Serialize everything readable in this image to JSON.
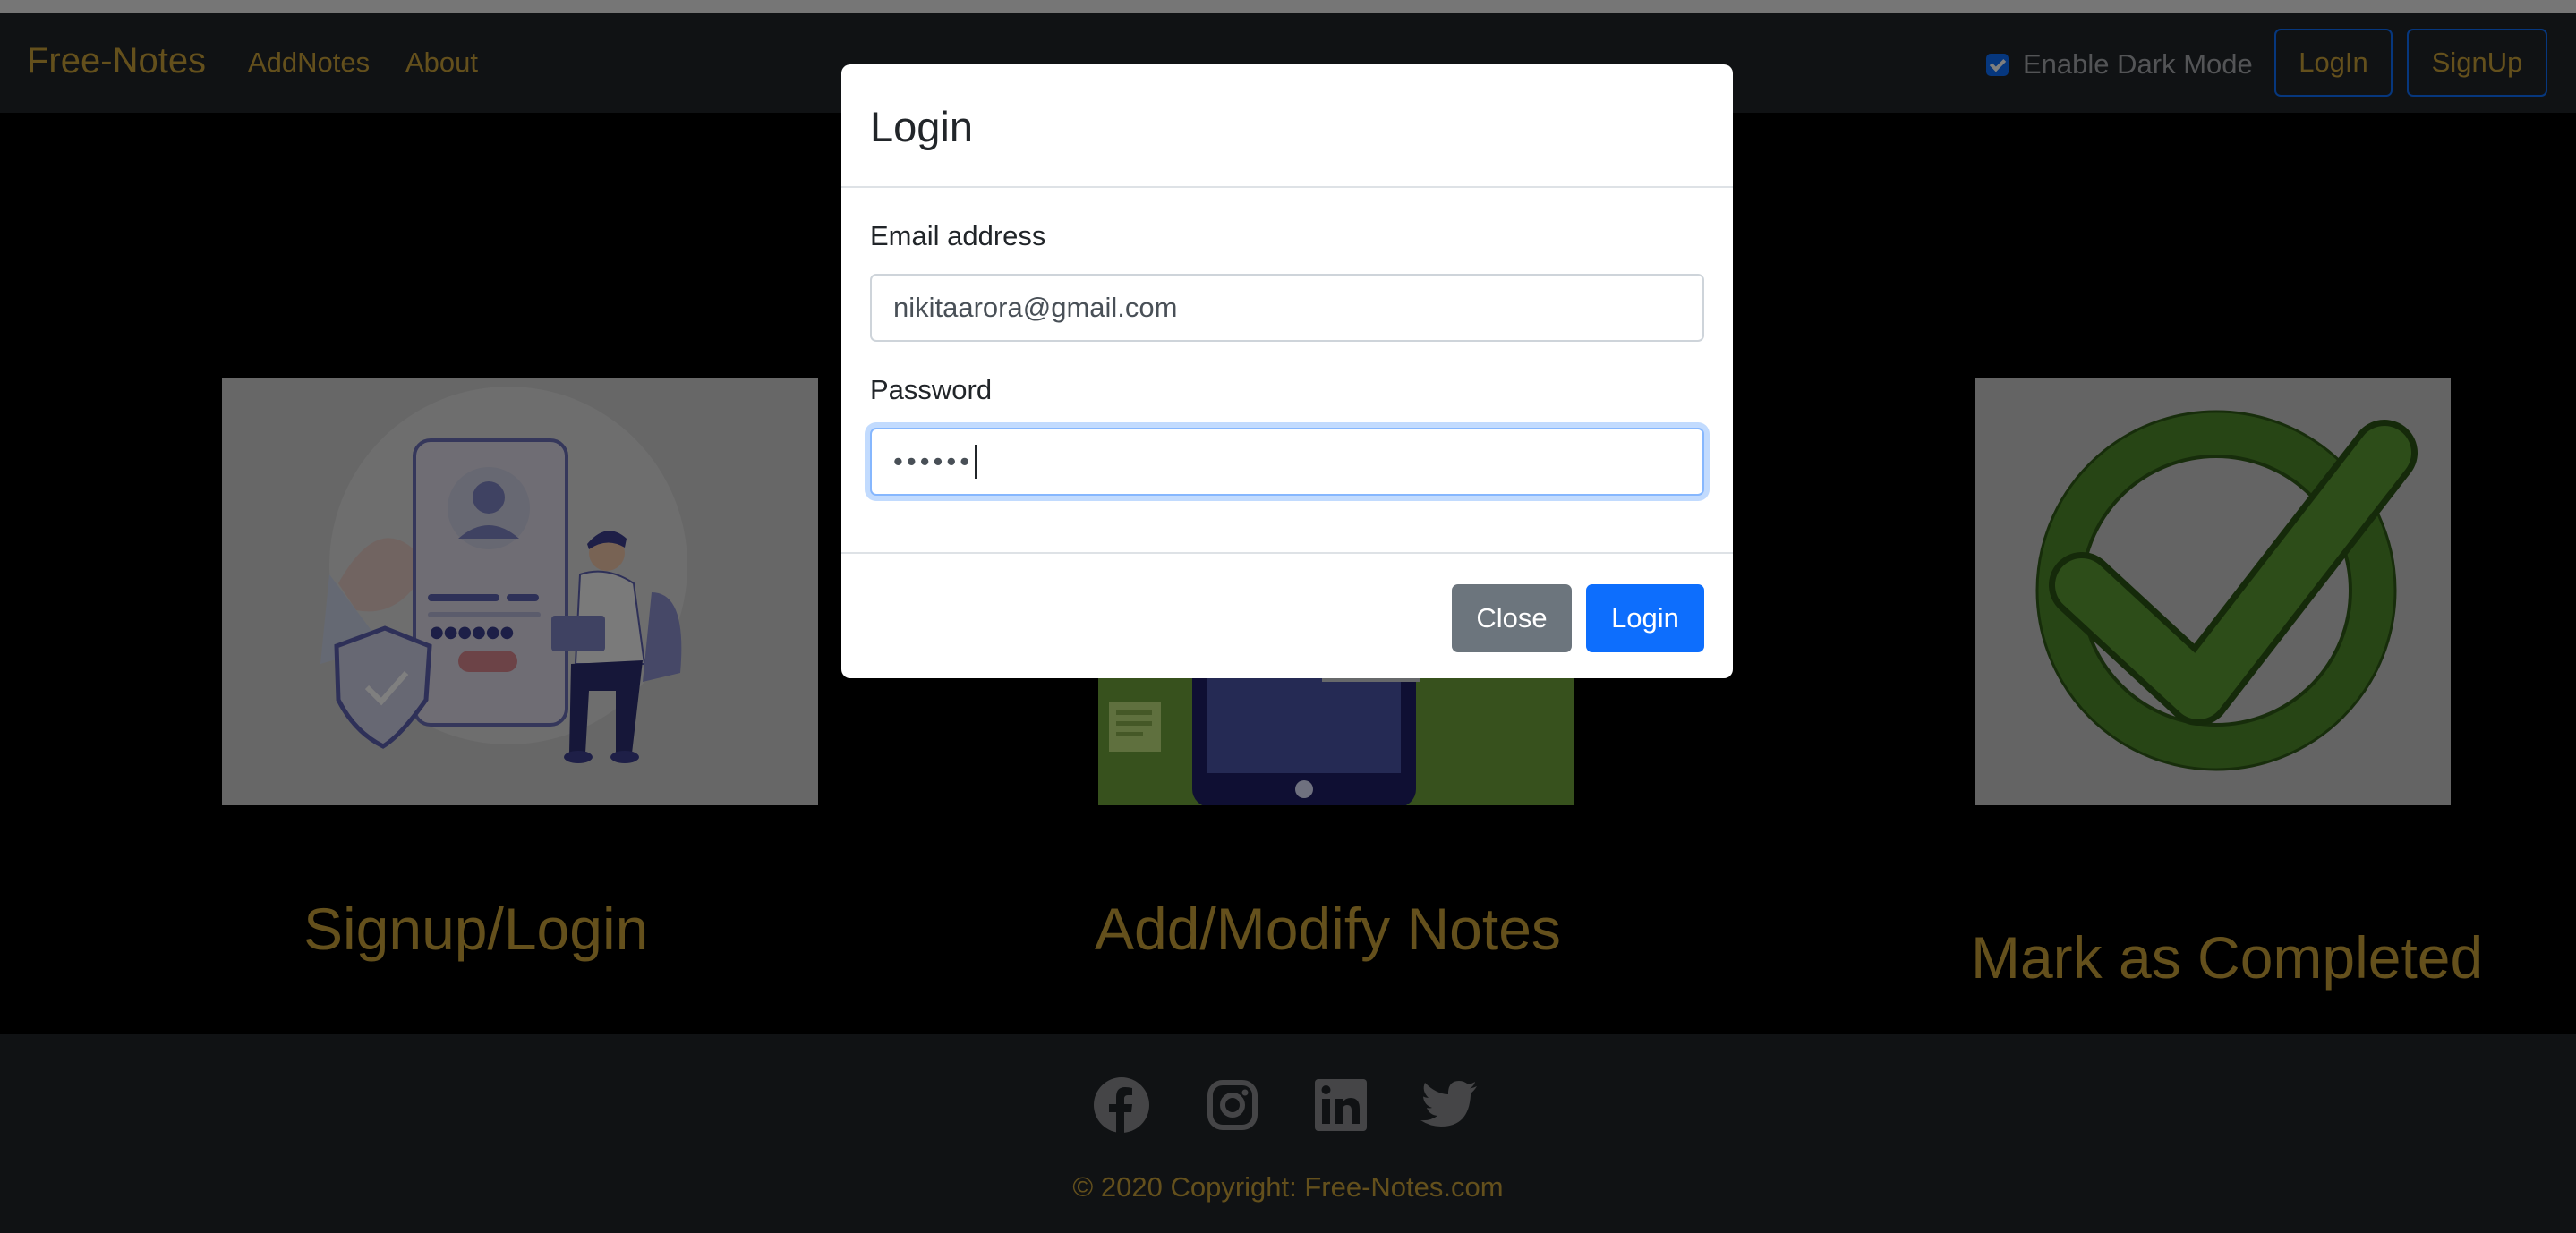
{
  "navbar": {
    "brand": "Free-Notes",
    "links": [
      "AddNotes",
      "About"
    ],
    "dark_mode_label": "Enable Dark Mode",
    "dark_mode_checked": true,
    "login_label": "LogIn",
    "signup_label": "SignUp"
  },
  "features": [
    {
      "title": "Signup/Login",
      "image": "signup-login-illustration"
    },
    {
      "title": "Add/Modify Notes",
      "image": "notes-tablet-illustration"
    },
    {
      "title": "Mark as Completed",
      "image": "green-checkmark-icon"
    }
  ],
  "footer": {
    "social": [
      "facebook-icon",
      "instagram-icon",
      "linkedin-icon",
      "twitter-icon"
    ],
    "copyright": "© 2020 Copyright: Free-Notes.com"
  },
  "modal": {
    "title": "Login",
    "email_label": "Email address",
    "email_value": "nikitaarora@gmail.com",
    "password_label": "Password",
    "password_value": "••••••",
    "close_label": "Close",
    "submit_label": "Login"
  },
  "colors": {
    "accent_gold": "#c8a038",
    "primary_blue": "#0d6efd",
    "navbar_bg": "#212529",
    "secondary_gray": "#6c757d"
  }
}
